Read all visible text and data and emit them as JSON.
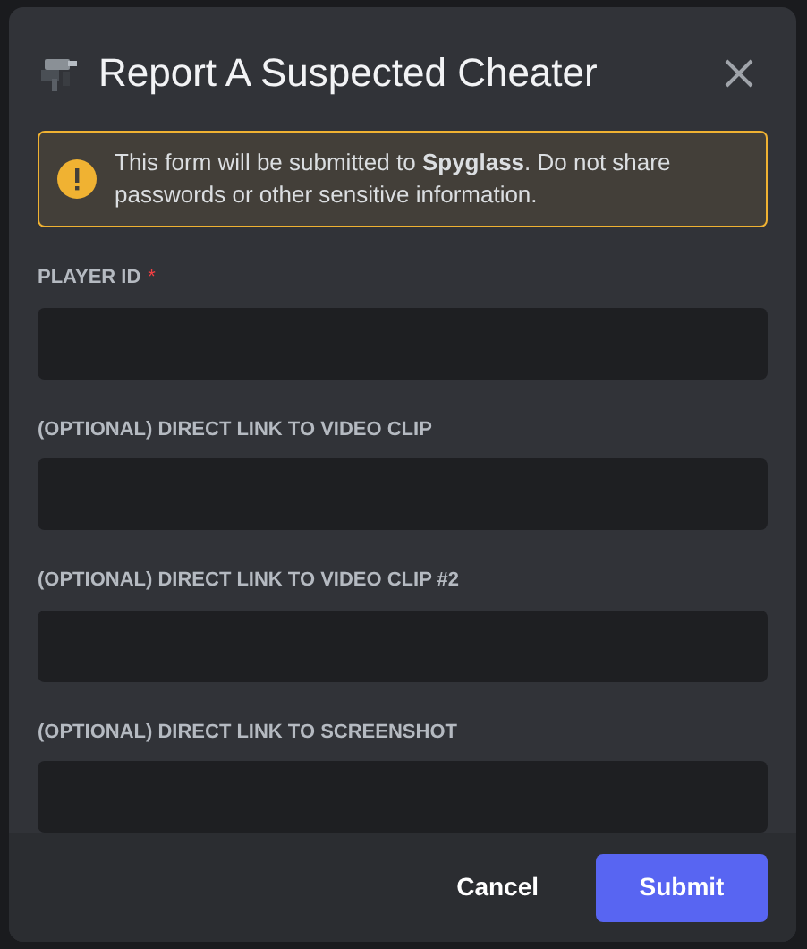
{
  "dialog": {
    "title": "Report A Suspected Cheater"
  },
  "notice": {
    "text": "This form will be submitted to **Spyglass**. Do not share passwords or other sensitive information."
  },
  "required_mark": "*",
  "fields": [
    {
      "label": "PLAYER ID",
      "required": true
    },
    {
      "label": "(OPTIONAL) DIRECT LINK TO VIDEO CLIP",
      "required": false
    },
    {
      "label": "(OPTIONAL) DIRECT LINK TO VIDEO CLIP #2",
      "required": false
    },
    {
      "label": "(OPTIONAL) DIRECT LINK TO SCREENSHOT",
      "required": false
    }
  ],
  "buttons": [
    {
      "label": "Cancel",
      "kind": "link"
    },
    {
      "label": "Submit",
      "kind": "primary"
    }
  ]
}
